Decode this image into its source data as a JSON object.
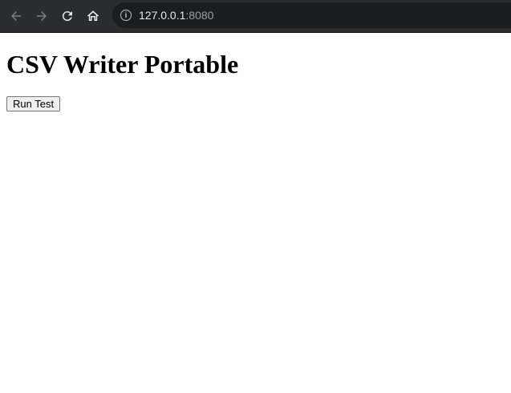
{
  "browser": {
    "url_host": "127.0.0.1",
    "url_port": ":8080",
    "icons": [
      "back-icon",
      "forward-icon",
      "reload-icon",
      "home-icon",
      "info-icon"
    ]
  },
  "page": {
    "title": "CSV Writer Portable",
    "run_button_label": "Run Test"
  }
}
